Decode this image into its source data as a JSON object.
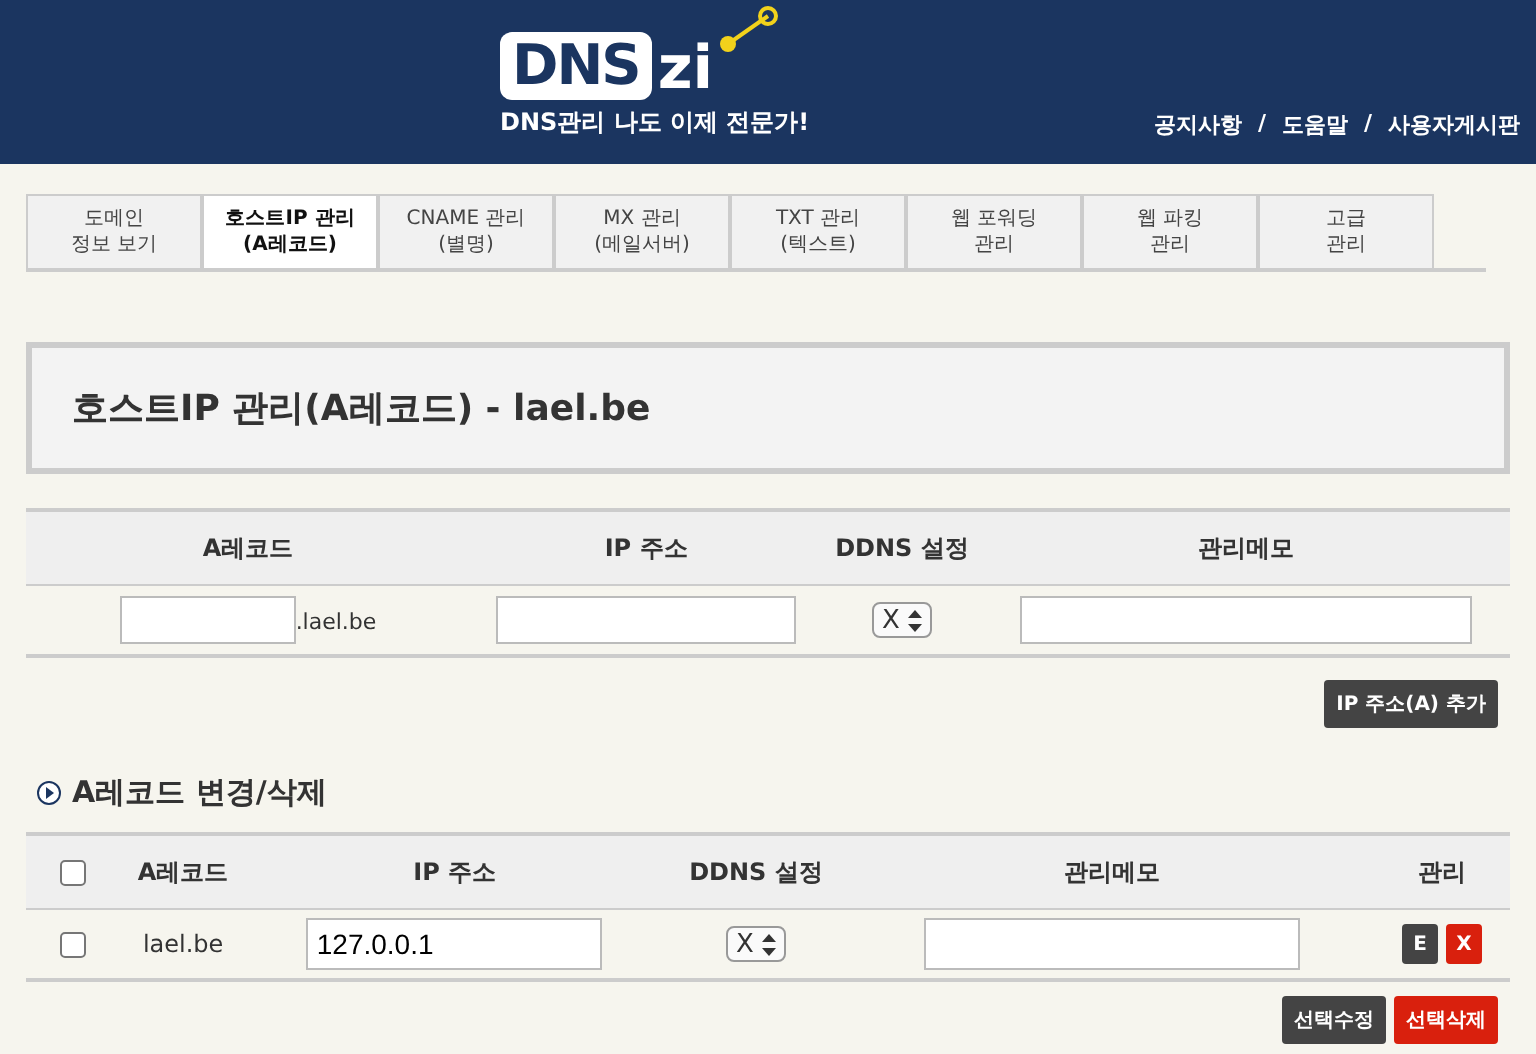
{
  "header": {
    "logo_box": "DNS",
    "logo_rest": "zi",
    "tagline": "DNS관리 나도 이제 전문가!",
    "links": [
      "공지사항",
      "도움말",
      "사용자게시판"
    ],
    "separator": "/"
  },
  "tabs": [
    {
      "lines": [
        "도메인",
        "정보 보기"
      ],
      "selected": false
    },
    {
      "lines": [
        "호스트IP 관리",
        "(A레코드)"
      ],
      "selected": true
    },
    {
      "lines": [
        "CNAME 관리",
        "(별명)"
      ],
      "selected": false
    },
    {
      "lines": [
        "MX 관리",
        "(메일서버)"
      ],
      "selected": false
    },
    {
      "lines": [
        "TXT 관리",
        "(텍스트)"
      ],
      "selected": false
    },
    {
      "lines": [
        "웹 포워딩",
        "관리"
      ],
      "selected": false
    },
    {
      "lines": [
        "웹 파킹",
        "관리"
      ],
      "selected": false
    },
    {
      "lines": [
        "고급",
        "관리"
      ],
      "selected": false
    }
  ],
  "page_title": "호스트IP 관리(A레코드) - lael.be",
  "add_form": {
    "columns": [
      "A레코드",
      "IP 주소",
      "DDNS 설정",
      "관리메모"
    ],
    "domain_suffix": ".lael.be",
    "ddns_value": "X",
    "add_button": "IP 주소(A) 추가"
  },
  "edit_section": {
    "heading": "A레코드 변경/삭제",
    "columns": [
      "A레코드",
      "IP 주소",
      "DDNS 설정",
      "관리메모",
      "관리"
    ],
    "rows": [
      {
        "checked": false,
        "record": "lael.be",
        "ip": "127.0.0.1",
        "ddns": "X",
        "edit_button": "E",
        "delete_button": "X"
      }
    ],
    "header_checked": false,
    "modify_button": "선택수정",
    "delete_button": "선택삭제"
  }
}
